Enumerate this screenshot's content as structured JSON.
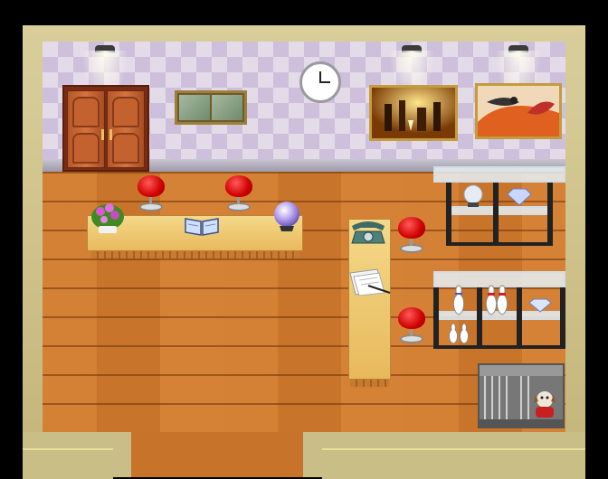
{
  "scene": {
    "type": "pet shop interior",
    "colors": {
      "frame": "#c6b987",
      "wall": "#e4dbe8",
      "floor": "#cf7a2f",
      "stool": "#e00000",
      "counter": "#f0cc78"
    }
  },
  "objects": {
    "door": "double-door",
    "window": "framed-window",
    "clock": "wall-clock",
    "painting_1": "wine-bottles-painting",
    "painting_2": "bird-painting",
    "counter_items": [
      "flower-pot",
      "open-book",
      "crystal-ball"
    ],
    "side_counter_items": [
      "telephone",
      "papers-with-pen"
    ],
    "shelf_1_items": [
      "crystal-ball",
      "gem"
    ],
    "shelf_2_items": [
      "bowling-pins-white",
      "bowling-pins-red",
      "gem"
    ],
    "cage": "dog-in-cage",
    "stools": 4
  }
}
